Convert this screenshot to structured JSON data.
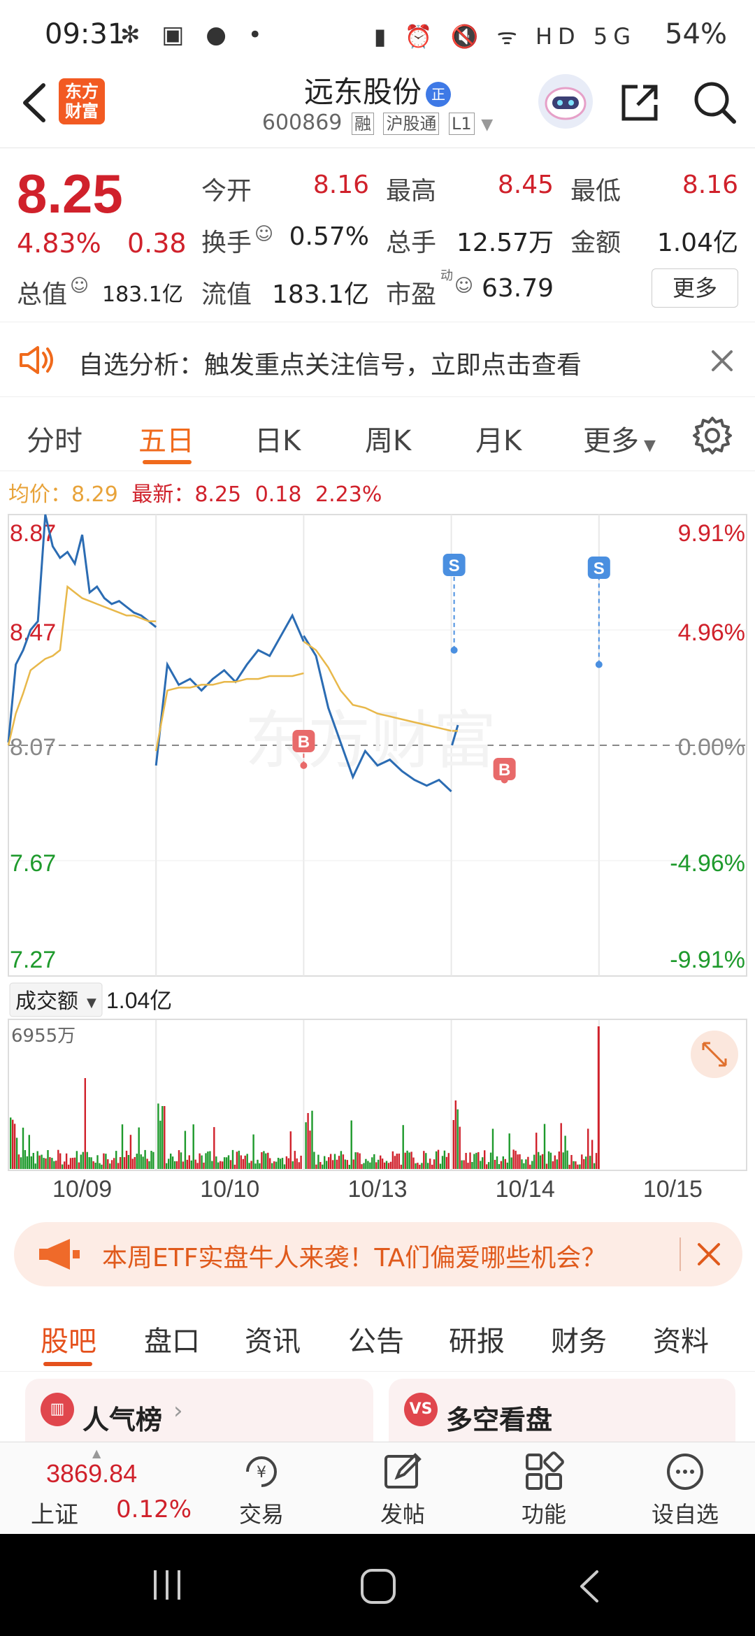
{
  "status_bar": {
    "time": "09:31",
    "left_icons": "✻ ▣ ● •",
    "battery": "54%",
    "right_icons": "▮ ⏰ 🔇 ᯤ HD 5G"
  },
  "header": {
    "logo_text_1": "东方",
    "logo_text_2": "财富",
    "stock_name": "远东股份",
    "badge": "正",
    "code": "600869",
    "tag_1": "融",
    "tag_2": "沪股通",
    "tag_3": "L1"
  },
  "quote": {
    "price": "8.25",
    "change_pct": "4.83%",
    "change": "0.38",
    "open_label": "今开",
    "open": "8.16",
    "high_label": "最高",
    "high": "8.45",
    "low_label": "最低",
    "low": "8.16",
    "turnover_label": "换手",
    "turnover": "0.57%",
    "volume_label": "总手",
    "volume": "12.57万",
    "amount_label": "金额",
    "amount": "1.04亿",
    "mcap_label": "总值",
    "mcap": "183.1亿",
    "float_label": "流值",
    "float_value": "183.1亿",
    "pe_label": "市盈",
    "pe_sup": "动",
    "pe": "63.79",
    "more": "更多"
  },
  "alert": {
    "text": "自选分析：触发重点关注信号，立即点击查看"
  },
  "tabs": [
    "分时",
    "五日",
    "日K",
    "周K",
    "月K",
    "更多"
  ],
  "active_tab": "五日",
  "avg_line": {
    "avg_label": "均价：8.29",
    "latest_label": "最新：8.25",
    "change": "0.18",
    "pct": "2.23%"
  },
  "colors": {
    "up": "#d0212b",
    "down": "#1e9a2c",
    "accent": "#f06a1c",
    "price_line": "#2b6cb3",
    "avg_line": "#e8b84a"
  },
  "chart_data": {
    "type": "line",
    "title": "",
    "price_axis": [
      "8.87",
      "8.47",
      "8.07",
      "7.67",
      "7.27"
    ],
    "pct_axis": [
      "9.91%",
      "4.96%",
      "0.00%",
      "-4.96%",
      "-9.91%"
    ],
    "x_labels": [
      "10/09",
      "10/10",
      "10/13",
      "10/14",
      "10/15"
    ],
    "ylim": [
      7.27,
      8.87
    ],
    "prev_close": 8.07,
    "series": [
      {
        "values": [
          8.08,
          8.35,
          8.4,
          8.47,
          8.5,
          8.87,
          8.76,
          8.72,
          8.74,
          8.7,
          8.8,
          8.6,
          8.62,
          8.58,
          8.56,
          8.57,
          8.55,
          8.53,
          8.52,
          8.5,
          8.48,
          8.0,
          8.35,
          8.28,
          8.3,
          8.26,
          8.3,
          8.33,
          8.29,
          8.35,
          8.4,
          8.38,
          8.45,
          8.52,
          8.43,
          8.45,
          8.38,
          8.2,
          8.08,
          7.96,
          8.05,
          8.0,
          8.02,
          7.98,
          7.95,
          7.93,
          7.95,
          7.91,
          8.07,
          8.14
        ]
      },
      {
        "values": [
          8.07,
          8.18,
          8.25,
          8.33,
          8.35,
          8.37,
          8.38,
          8.4,
          8.62,
          8.6,
          8.58,
          8.57,
          8.56,
          8.55,
          8.54,
          8.53,
          8.52,
          8.52,
          8.51,
          8.5,
          8.5,
          8.05,
          8.26,
          8.27,
          8.27,
          8.28,
          8.28,
          8.29,
          8.29,
          8.3,
          8.3,
          8.31,
          8.31,
          8.31,
          8.32,
          8.43,
          8.4,
          8.34,
          8.26,
          8.21,
          8.2,
          8.18,
          8.17,
          8.16,
          8.15,
          8.14,
          8.13,
          8.12,
          8.12,
          8.12
        ]
      }
    ],
    "markers": [
      {
        "label": "B",
        "day": 2
      },
      {
        "label": "S",
        "day": 3
      },
      {
        "label": "B",
        "day": 3
      },
      {
        "label": "S",
        "day": 4
      }
    ]
  },
  "volume": {
    "dropdown_label": "成交额",
    "value": "1.04亿",
    "max_label": "6955万"
  },
  "promo": {
    "text": "本周ETF实盘牛人来袭！TA们偏爱哪些机会？"
  },
  "bottom_tabs": [
    "股吧",
    "盘口",
    "资讯",
    "公告",
    "研报",
    "财务",
    "资料"
  ],
  "cards": [
    {
      "title": "人气榜",
      "icon": "ranking-icon"
    },
    {
      "title": "多空看盘",
      "icon": "vs-icon"
    }
  ],
  "bottom_nav": {
    "index_value": "3869.84",
    "index_name": "上证",
    "index_pct": "0.12%",
    "items": [
      "交易",
      "发帖",
      "功能",
      "设自选"
    ]
  }
}
